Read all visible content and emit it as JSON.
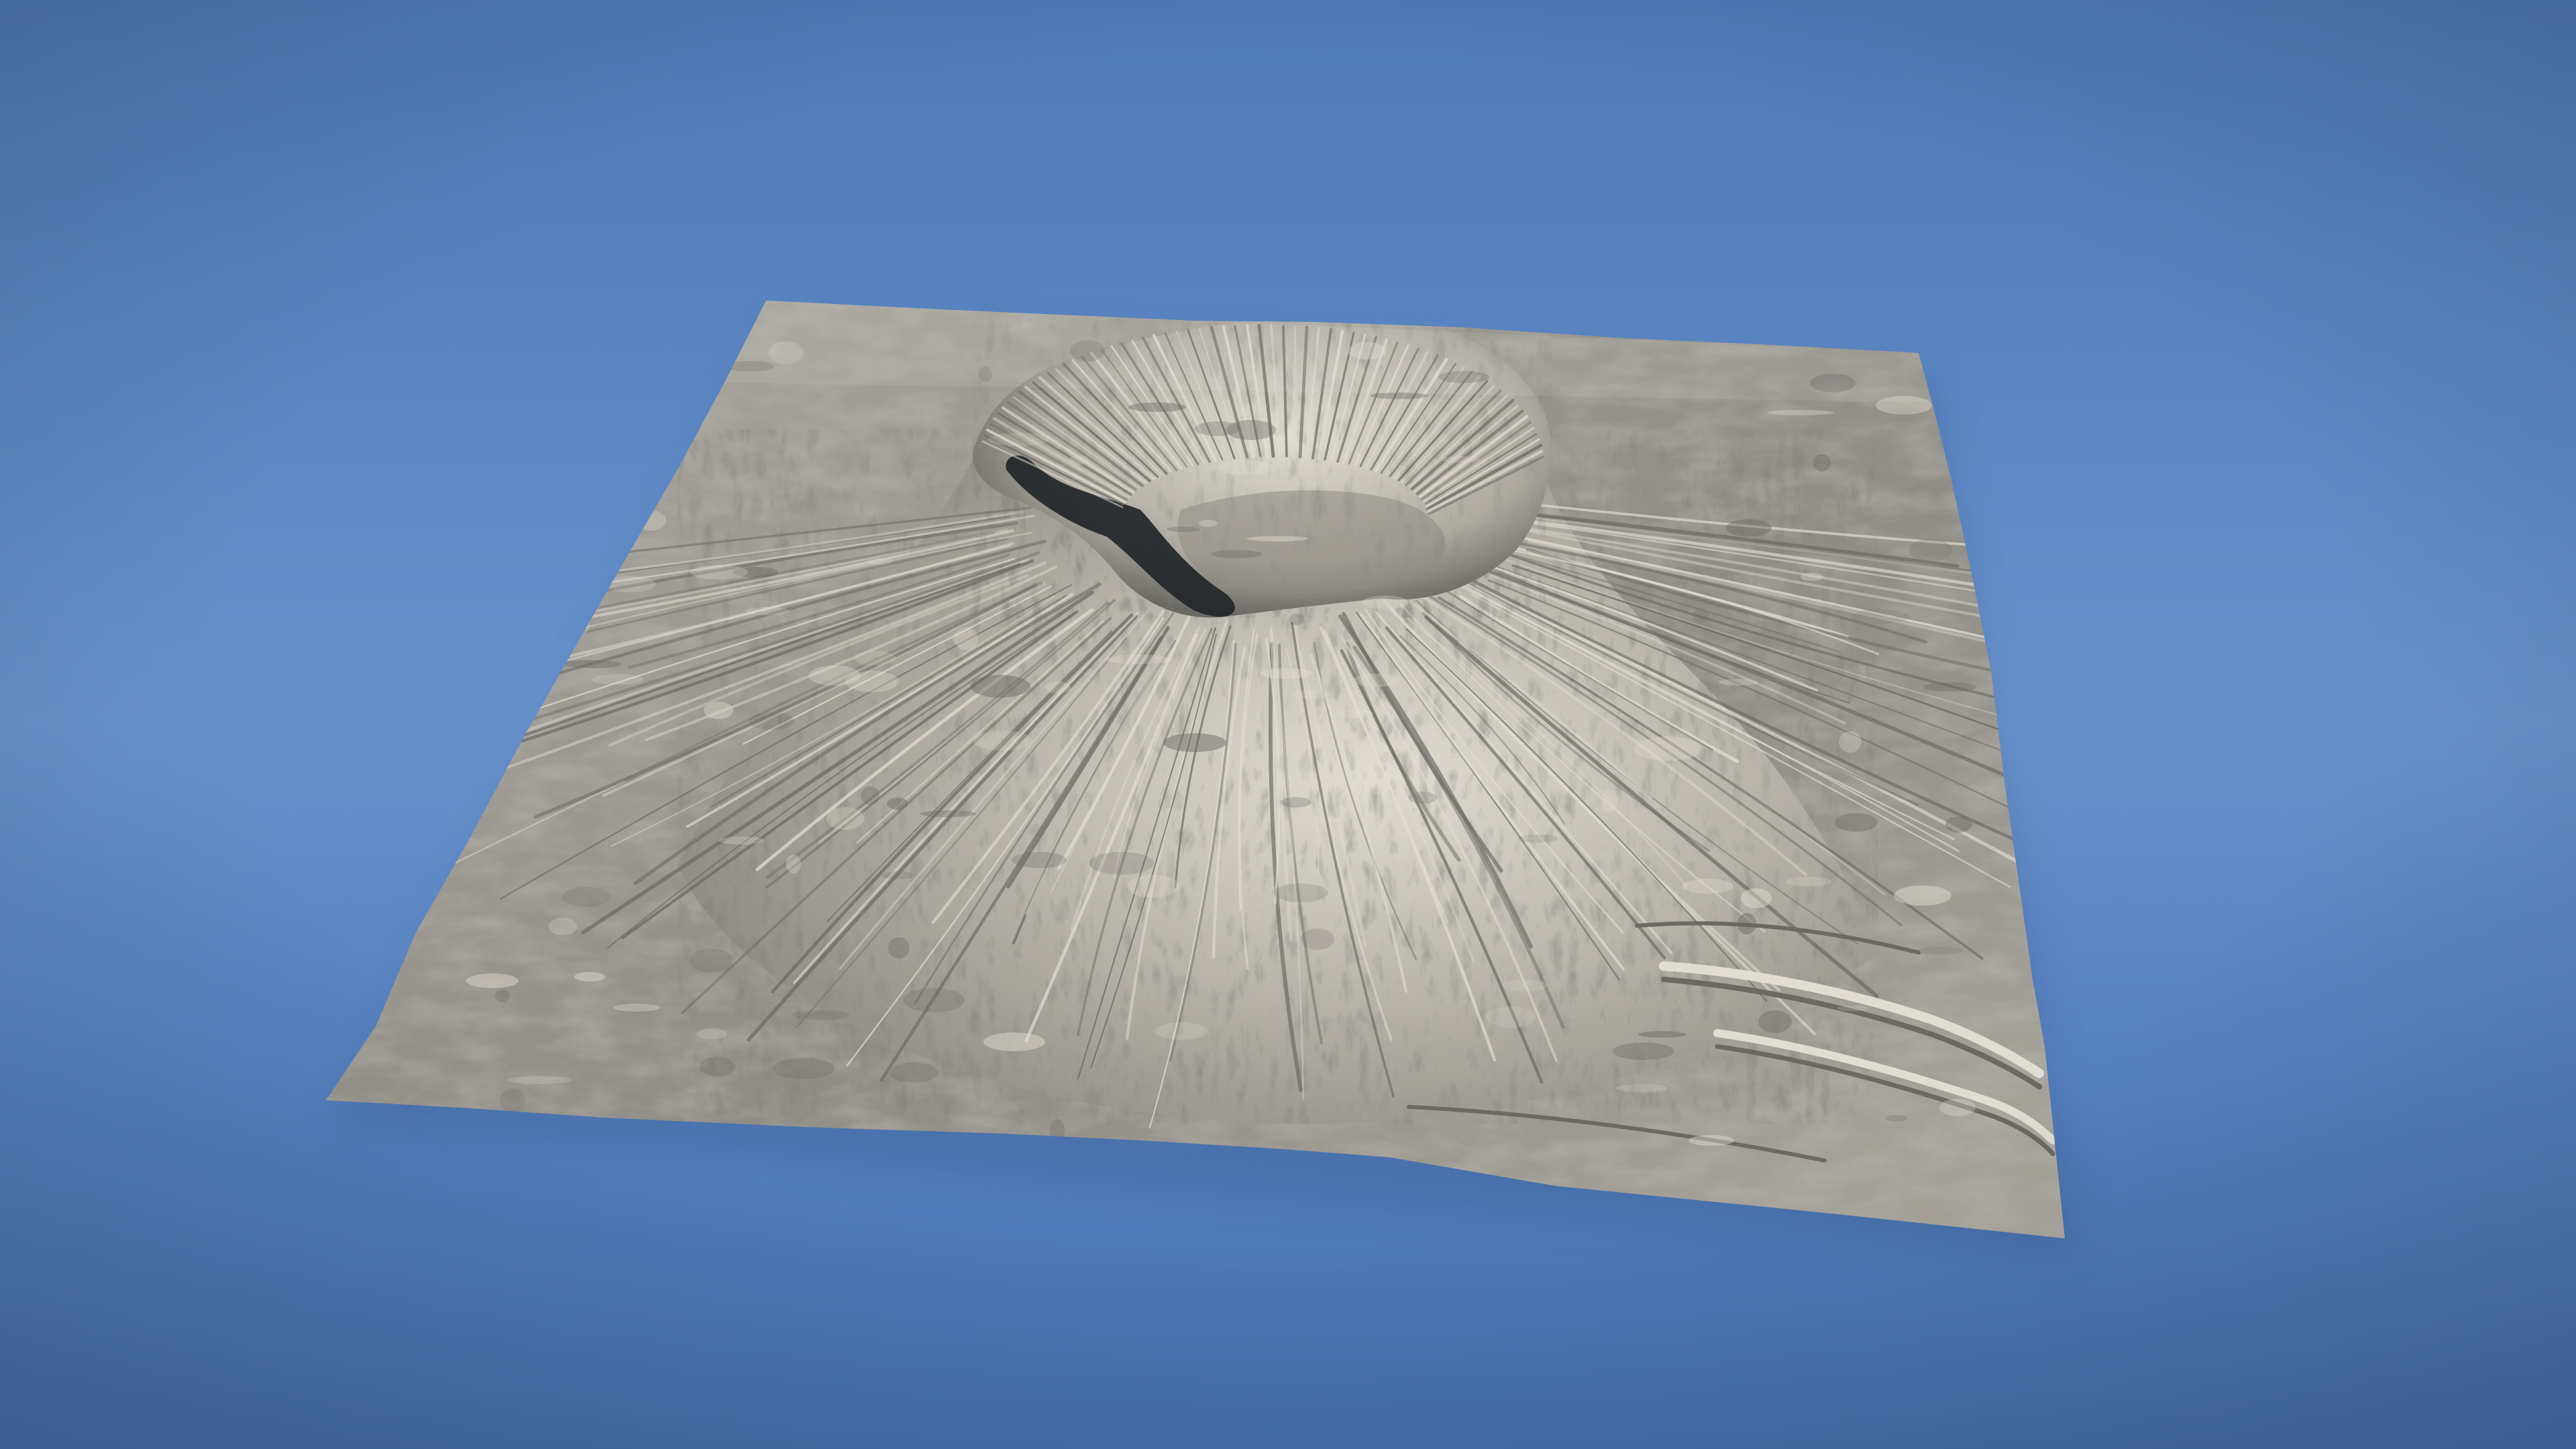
{
  "viewport": {
    "sky_colors": {
      "top": "#4f7ab8",
      "upper_mid": "#5d88c4",
      "center": "#6790ca",
      "lower_mid": "#5581c0",
      "bottom": "#4670ae"
    },
    "terrain": {
      "type": "volcano-heightmap",
      "features": [
        "summit-crater",
        "radial-erosion-gullies",
        "lava-flow-terraces"
      ],
      "colors": {
        "highlight": "#e2ddd2",
        "base": "#aeaaa1",
        "mid": "#8f8c85",
        "shade": "#6b6964",
        "deep_shadow": "#222629"
      }
    }
  }
}
